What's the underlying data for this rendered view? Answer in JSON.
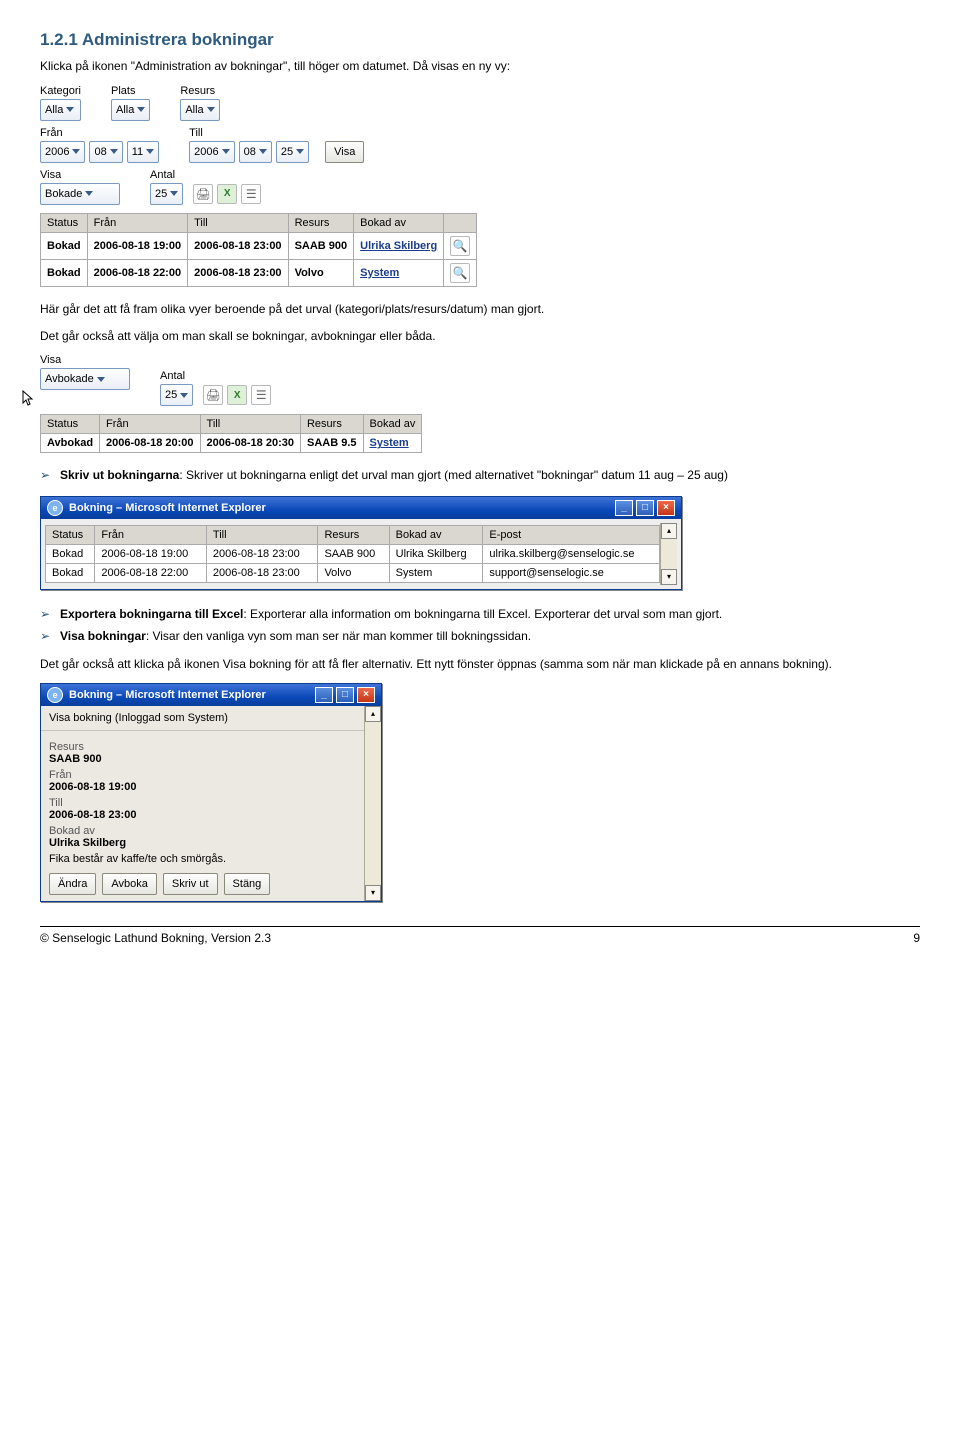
{
  "heading": "1.2.1 Administrera bokningar",
  "intro": "Klicka på ikonen \"Administration av bokningar\", till höger om datumet. Då visas en ny vy:",
  "filters_a": {
    "kategori_label": "Kategori",
    "kategori_value": "Alla",
    "plats_label": "Plats",
    "plats_value": "Alla",
    "resurs_label": "Resurs",
    "resurs_value": "Alla",
    "fran_label": "Från",
    "fran_y": "2006",
    "fran_m": "08",
    "fran_d": "11",
    "till_label": "Till",
    "till_y": "2006",
    "till_m": "08",
    "till_d": "25",
    "visa_btn": "Visa",
    "visa_label": "Visa",
    "visa_value": "Bokade",
    "antal_label": "Antal",
    "antal_value": "25"
  },
  "table_a": {
    "headers": {
      "status": "Status",
      "fran": "Från",
      "till": "Till",
      "resurs": "Resurs",
      "bokad": "Bokad av",
      "act": ""
    },
    "rows": [
      {
        "status": "Bokad",
        "fran": "2006-08-18 19:00",
        "till": "2006-08-18 23:00",
        "resurs": "SAAB 900",
        "bokad": "Ulrika Skilberg"
      },
      {
        "status": "Bokad",
        "fran": "2006-08-18 22:00",
        "till": "2006-08-18 23:00",
        "resurs": "Volvo",
        "bokad": "System"
      }
    ]
  },
  "mid_para1": "Här går det att få fram olika vyer beroende på det urval (kategori/plats/resurs/datum) man gjort.",
  "mid_para2": "Det går också att välja om man skall se bokningar, avbokningar eller båda.",
  "filters_b": {
    "visa_label": "Visa",
    "visa_value": "Avbokade",
    "antal_label": "Antal",
    "antal_value": "25"
  },
  "table_b": {
    "headers": {
      "status": "Status",
      "fran": "Från",
      "till": "Till",
      "resurs": "Resurs",
      "bokad": "Bokad av"
    },
    "rows": [
      {
        "status": "Avbokad",
        "fran": "2006-08-18 20:00",
        "till": "2006-08-18 20:30",
        "resurs": "SAAB 9.5",
        "bokad": "System"
      }
    ]
  },
  "bullet_print": {
    "label": "Skriv ut bokningarna",
    "text": ": Skriver ut bokningarna enligt det urval man gjort (med alternativet \"bokningar\" datum 11 aug – 25 aug)"
  },
  "win1": {
    "title": "Bokning – Microsoft Internet Explorer",
    "headers": {
      "status": "Status",
      "fran": "Från",
      "till": "Till",
      "resurs": "Resurs",
      "bokad": "Bokad av",
      "epost": "E-post"
    },
    "rows": [
      {
        "status": "Bokad",
        "fran": "2006-08-18 19:00",
        "till": "2006-08-18 23:00",
        "resurs": "SAAB 900",
        "bokad": "Ulrika Skilberg",
        "epost": "ulrika.skilberg@senselogic.se"
      },
      {
        "status": "Bokad",
        "fran": "2006-08-18 22:00",
        "till": "2006-08-18 23:00",
        "resurs": "Volvo",
        "bokad": "System",
        "epost": "support@senselogic.se"
      }
    ]
  },
  "bullet_excel": {
    "label": "Exportera bokningarna till Excel",
    "text": ": Exporterar alla information om bokningarna till Excel. Exporterar det urval som man gjort."
  },
  "bullet_visa": {
    "label": "Visa bokningar",
    "text": ": Visar den vanliga vyn som man ser när man kommer till bokningssidan."
  },
  "alt_para": "Det går också att klicka på ikonen Visa bokning för att få fler alternativ. Ett nytt fönster öppnas (samma som när man klickade på en annans bokning).",
  "win2": {
    "title": "Bokning – Microsoft Internet Explorer",
    "caption": "Visa bokning (Inloggad som System)",
    "resurs_label": "Resurs",
    "resurs": "SAAB 900",
    "fran_label": "Från",
    "fran": "2006-08-18 19:00",
    "till_label": "Till",
    "till": "2006-08-18 23:00",
    "bokad_label": "Bokad av",
    "bokad": "Ulrika Skilberg",
    "note": "Fika består av kaffe/te och smörgås.",
    "buttons": {
      "andra": "Ändra",
      "avboka": "Avboka",
      "skriv": "Skriv ut",
      "stang": "Stäng"
    }
  },
  "footer": {
    "left": "© Senselogic Lathund Bokning, Version 2.3",
    "right": "9"
  }
}
